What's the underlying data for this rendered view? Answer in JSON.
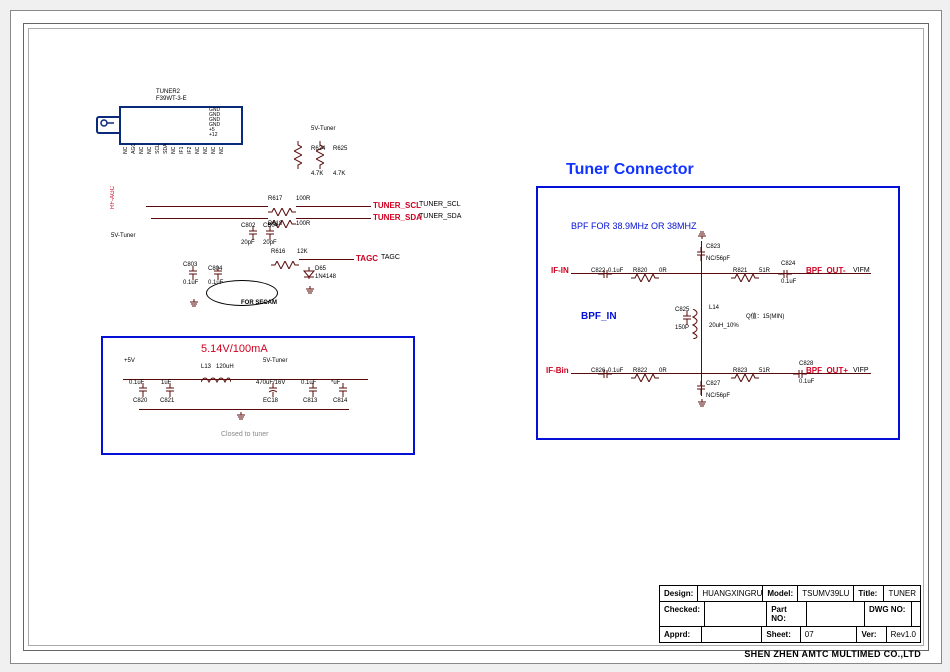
{
  "title_block": {
    "design_label": "Design:",
    "design_value": "HUANGXINGRU",
    "model_label": "Model:",
    "model_value": "TSUMV39LU",
    "title_label": "Title:",
    "title_value": "TUNER",
    "checked_label": "Checked:",
    "checked_value": "",
    "partno_label": "Part NO:",
    "partno_value": "",
    "dwgno_label": "DWG NO:",
    "dwgno_value": "",
    "apprd_label": "Apprd:",
    "apprd_value": "",
    "sheet_label": "Sheet:",
    "sheet_value": "07",
    "ver_label": "Ver:",
    "ver_value": "Rev1.0"
  },
  "company": "SHEN ZHEN AMTC MULTIMED CO.,LTD",
  "tuner2": {
    "ref": "TUNER2",
    "part": "F39WT-3-E",
    "pins": [
      "NC",
      "AGC",
      "NC",
      "NC",
      "SCL",
      "SDA",
      "NC",
      "IF1",
      "IF2",
      "NC",
      "NC",
      "NC",
      "NC"
    ],
    "gnds": [
      "GND",
      "GND",
      "GND",
      "GND",
      "+5",
      "+12"
    ]
  },
  "nets": {
    "rf_agc": "RF-AGC",
    "fivev_tuner": "5V-Tuner",
    "tuner_scl": "TUNER_SCL",
    "tuner_sda": "TUNER_SDA",
    "tagc": "TAGC",
    "if_in": "IF-IN",
    "if_bin": "IF-Bin",
    "bpf_outm": "BPF_OUT-",
    "bpf_outp": "BPF_OUT+",
    "vifm": "VIFM",
    "vifp": "VIFP"
  },
  "tuner_circuit": {
    "r617": {
      "ref": "R617",
      "val": "100R"
    },
    "r618": {
      "ref": "R618",
      "val": "100R"
    },
    "r624": {
      "ref": "R624",
      "val": "4.7K"
    },
    "r625": {
      "ref": "R625",
      "val": "4.7K"
    },
    "r616": {
      "ref": "R616",
      "val": "12K"
    },
    "c803": {
      "ref": "C803",
      "val": "0.1uF"
    },
    "c804": {
      "ref": "C804",
      "val": "0.1uF"
    },
    "c802": {
      "ref": "C802",
      "val": "20pF"
    },
    "cb04": {
      "ref": "CB04",
      "val": "20pF"
    },
    "d65": {
      "ref": "D65",
      "val": "1N4148"
    },
    "secam_note": "FOR SECAM"
  },
  "power_box": {
    "header": "5.14V/100mA",
    "plus5": "+5V",
    "fivev_tuner": "5V-Tuner",
    "c820": {
      "ref": "C820",
      "val": "0.1uF"
    },
    "c821": {
      "ref": "C821",
      "val": "1uF"
    },
    "l13": {
      "ref": "L13",
      "val": "120uH"
    },
    "ec18": {
      "ref": "EC18",
      "val": "470uF/16V"
    },
    "c813": {
      "ref": "C813",
      "val": "0.1uF"
    },
    "c814": {
      "ref": "C814",
      "val": "*uF"
    },
    "note": "Closed to tuner"
  },
  "tuner_connector": {
    "title": "Tuner Connector",
    "bpf_note": "BPF FOR 38.9MHz OR 38MHZ",
    "bpf_in": "BPF_IN",
    "q_note": "Q值：15(MIN)",
    "c822": {
      "ref": "C822",
      "val": "0.1uF"
    },
    "c826": {
      "ref": "C826",
      "val": "0.1uF"
    },
    "c823": {
      "ref": "C823",
      "val": "NC/56pF"
    },
    "c825": {
      "ref": "C825",
      "val": "150P"
    },
    "c827": {
      "ref": "C827",
      "val": "NC/56pF"
    },
    "c824": {
      "ref": "C824",
      "val": "0.1uF"
    },
    "c828": {
      "ref": "C828",
      "val": "0.1uF"
    },
    "r820": {
      "ref": "R820",
      "val": "0R"
    },
    "r822": {
      "ref": "R822",
      "val": "0R"
    },
    "r821": {
      "ref": "R821",
      "val": "51R"
    },
    "r823": {
      "ref": "R823",
      "val": "51R"
    },
    "l14": {
      "ref": "L14",
      "val": "20uH_10%"
    }
  }
}
